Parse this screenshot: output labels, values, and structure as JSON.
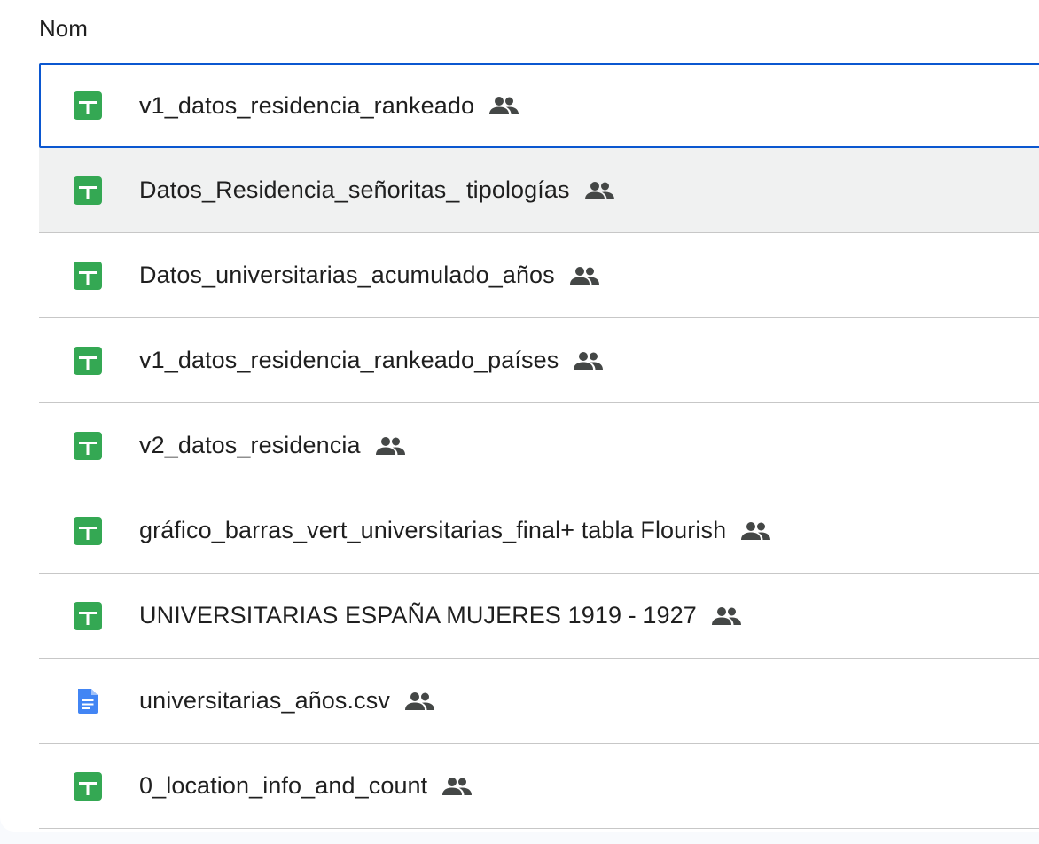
{
  "header": {
    "name_column_label": "Nom"
  },
  "colors": {
    "sheets_green": "#188038",
    "sheets_green_light": "#34a853",
    "docs_blue": "#4285f4",
    "selected_outline": "#0b57d0",
    "hover_bg": "#f0f1f1",
    "divider": "#c7c7c7",
    "text": "#1f1f1f",
    "shared_icon": "#444746"
  },
  "files": [
    {
      "name": "v1_datos_residencia_rankeado",
      "type_icon": "sheets-icon",
      "shared_icon": "people-icon",
      "state": "selected"
    },
    {
      "name": "Datos_Residencia_señoritas_ tipologías",
      "type_icon": "sheets-icon",
      "shared_icon": "people-icon",
      "state": "hover"
    },
    {
      "name": "Datos_universitarias_acumulado_años",
      "type_icon": "sheets-icon",
      "shared_icon": "people-icon",
      "state": ""
    },
    {
      "name": "v1_datos_residencia_rankeado_países",
      "type_icon": "sheets-icon",
      "shared_icon": "people-icon",
      "state": ""
    },
    {
      "name": "v2_datos_residencia",
      "type_icon": "sheets-icon",
      "shared_icon": "people-icon",
      "state": ""
    },
    {
      "name": "gráfico_barras_vert_universitarias_final+ tabla Flourish",
      "type_icon": "sheets-icon",
      "shared_icon": "people-icon",
      "state": ""
    },
    {
      "name": "UNIVERSITARIAS ESPAÑA MUJERES 1919 - 1927",
      "type_icon": "sheets-icon",
      "shared_icon": "people-icon",
      "state": ""
    },
    {
      "name": "universitarias_años.csv",
      "type_icon": "docs-icon",
      "shared_icon": "people-icon",
      "state": ""
    },
    {
      "name": "0_location_info_and_count",
      "type_icon": "sheets-icon",
      "shared_icon": "people-icon",
      "state": ""
    }
  ]
}
